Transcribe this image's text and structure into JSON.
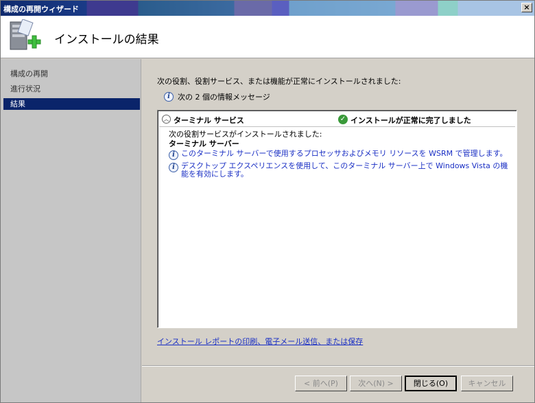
{
  "window": {
    "title": "構成の再開ウィザード",
    "close_label": "×"
  },
  "header": {
    "title": "インストールの結果"
  },
  "sidebar": {
    "items": [
      {
        "label": "構成の再開",
        "active": false
      },
      {
        "label": "進行状況",
        "active": false
      },
      {
        "label": "結果",
        "active": true
      }
    ]
  },
  "main": {
    "description": "次の役割、役割サービス、または機能が正常にインストールされました:",
    "info_summary": "次の 2 個の情報メッセージ",
    "results": {
      "role": "ターミナル サービス",
      "status": "インストールが正常に完了しました",
      "sub_heading": "次の役割サービスがインストールされました:",
      "service_name": "ターミナル サーバー",
      "messages": [
        "このターミナル サーバーで使用するプロセッサおよびメモリ リソースを WSRM で管理します。",
        "デスクトップ エクスペリエンスを使用して、このターミナル サーバー上で Windows Vista の機能を有効にします。"
      ]
    },
    "report_link": "インストール レポートの印刷、電子メール送信、または保存"
  },
  "footer": {
    "back_label": "< 前へ(P)",
    "next_label": "次へ(N) >",
    "close_label": "閉じる(O)",
    "cancel_label": "キャンセル"
  },
  "colors": {
    "selection": "#0a246a",
    "link": "#1a2fc4",
    "success": "#3a9a3a",
    "sidebar_bg": "#c6c6c6",
    "dialog_bg": "#d4d0c8"
  }
}
